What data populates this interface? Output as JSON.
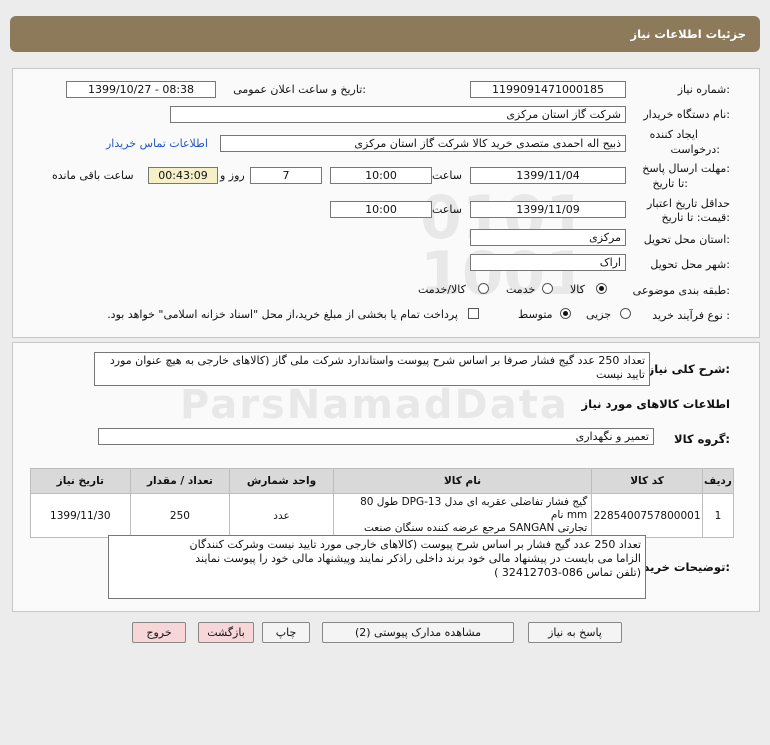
{
  "header": {
    "title": "جزئیات اطلاعات نیاز"
  },
  "form": {
    "need_number_label": "شماره نیاز:",
    "need_number": "1199091471000185",
    "announce_label": "تاریخ و ساعت اعلان عمومی:",
    "announce_value": "1399/10/27 - 08:38",
    "buyer_org_label": "نام دستگاه خریدار:",
    "buyer_org": "شرکت گاز استان مرکزی",
    "creator_label_1": "ایجاد کننده",
    "creator_label_2": "درخواست:",
    "creator": "ذبیح اله احمدی متصدی خرید کالا شرکت گاز استان مرکزی",
    "contact_link": "اطلاعات تماس خریدار",
    "reply_deadline_label_1": "مهلت ارسال پاسخ:",
    "reply_deadline_label_2": "تا تاریخ:",
    "reply_date": "1399/11/04",
    "time_label": "ساعت",
    "reply_time": "10:00",
    "days_value": "7",
    "days_label": "روز و",
    "remaining_time": "00:43:09",
    "remaining_label": "ساعت باقی مانده",
    "price_validity_label_1": "حداقل تاریخ اعتبار",
    "price_validity_label_2": "قیمت: تا تاریخ:",
    "validity_date": "1399/11/09",
    "validity_time": "10:00",
    "province_label": "استان محل تحویل:",
    "province": "مرکزی",
    "city_label": "شهر محل تحویل:",
    "city": "اراک",
    "category_label": "طبقه بندی موضوعی:",
    "category_options": [
      "کالا",
      "خدمت",
      "کالا/خدمت"
    ],
    "category_selected": "کالا",
    "purchase_type_label": "نوع فرآیند خرید :",
    "purchase_options": [
      "جزیی",
      "متوسط"
    ],
    "purchase_selected": "متوسط",
    "treasury_note": "پرداخت تمام یا بخشی از مبلغ خرید،از محل \"اسناد خزانه اسلامی\" خواهد بود."
  },
  "description": {
    "label": "شرح کلی نیاز:",
    "text": "تعداد 250 عدد گیج فشار صرفا بر اساس شرح پیوست واستاندارد شرکت ملی گاز (کالاهای خارجی به هیچ عنوان مورد تایید نیست"
  },
  "goods": {
    "section_title": "اطلاعات کالاهای مورد نیاز",
    "group_label": "گروه کالا:",
    "group_value": "تعمیر و نگهداری",
    "columns": [
      "ردیف",
      "کد کالا",
      "نام کالا",
      "واحد شمارش",
      "تعداد / مقدار",
      "تاریخ نیاز"
    ],
    "rows": [
      {
        "index": "1",
        "code": "2285400757800001",
        "name_line1": "گیج فشار تفاضلی عقربه ای مدل DPG-13 طول 80 mm نام",
        "name_line2": "تجارتی SANGAN مرجع عرضه کننده سنگان صنعت",
        "unit": "عدد",
        "qty": "250",
        "date": "1399/11/30"
      }
    ]
  },
  "buyer_notes": {
    "label": "توضیحات خریدار:",
    "line1": "تعداد 250 عدد گیج فشار بر اساس شرح پیوست (کالاهای خارجی مورد تایید نیست وشرکت کنندگان",
    "line2": "الزاما می بایست  در پیشنهاد مالی خود برند داخلی راذکر نمایند وپیشنهاد مالی خود را پیوست نمایند",
    "line3": "(تلفن تماس 086-32412703 )"
  },
  "buttons": {
    "reply": "پاسخ به نیاز",
    "view_docs": "مشاهده مدارک پیوستی (2)",
    "print": "چاپ",
    "back": "بازگشت",
    "exit": "خروج"
  }
}
